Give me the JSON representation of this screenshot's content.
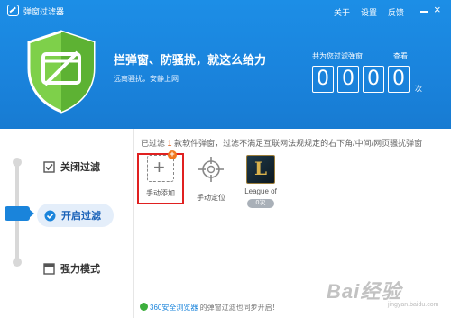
{
  "window": {
    "title": "弹窗过滤器"
  },
  "titlebar": {
    "about": "关于",
    "settings": "设置",
    "feedback": "反馈",
    "close": "×"
  },
  "hero": {
    "headline": "拦弹窗、防骚扰，就这么给力",
    "subline": "远离骚扰，安静上网"
  },
  "counter": {
    "label": "共为您过滤弹窗",
    "view_link": "查看",
    "digits": [
      "0",
      "0",
      "0",
      "0"
    ],
    "unit": "次"
  },
  "modes": [
    {
      "label": "关闭过滤",
      "icon": "checkbox-icon",
      "active": false
    },
    {
      "label": "开启过滤",
      "icon": "check-circle-icon",
      "active": true
    },
    {
      "label": "强力模式",
      "icon": "window-icon",
      "active": false
    }
  ],
  "notice": {
    "prefix": "已过滤",
    "count": "1",
    "suffix": "款软件弹窗，过滤不满足互联网法规规定的右下角/中间/网页骚扰弹窗"
  },
  "items": [
    {
      "label": "手动添加",
      "icon": "plus-icon",
      "badge": "+"
    },
    {
      "label": "手动定位",
      "icon": "crosshair-icon"
    },
    {
      "label": "League of",
      "icon": "league-of-legends-icon",
      "icon_text": "L",
      "count": "0次"
    }
  ],
  "footer": {
    "brand": "360安全浏览器",
    "text": "的弹窗过滤也同步开启！"
  },
  "watermark": {
    "text": "Bai经验",
    "sub": "jingyan.baidu.com"
  },
  "colors": {
    "header": "#1a84db",
    "accent": "#1a62b8",
    "highlight": "#e02020",
    "badge": "#f07820"
  }
}
